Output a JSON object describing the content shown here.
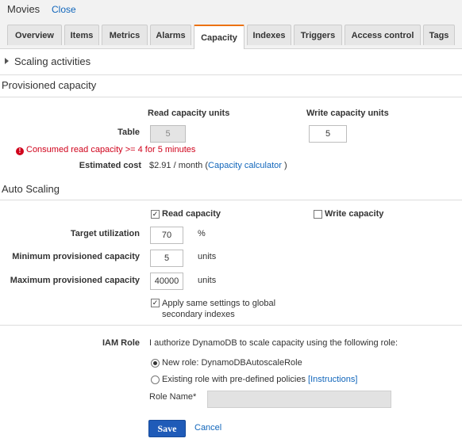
{
  "header": {
    "title": "Movies",
    "close_label": "Close"
  },
  "tabs": [
    {
      "label": "Overview"
    },
    {
      "label": "Items"
    },
    {
      "label": "Metrics"
    },
    {
      "label": "Alarms"
    },
    {
      "label": "Capacity",
      "active": true
    },
    {
      "label": "Indexes"
    },
    {
      "label": "Triggers"
    },
    {
      "label": "Access control"
    },
    {
      "label": "Tags"
    }
  ],
  "scaling_activities": {
    "label": "Scaling activities"
  },
  "provisioned": {
    "heading": "Provisioned capacity",
    "read_head": "Read capacity units",
    "write_head": "Write capacity units",
    "table_label": "Table",
    "read_value": "5",
    "write_value": "5",
    "error_text": "Consumed read capacity >= 4 for 5 minutes",
    "cost_label": "Estimated cost",
    "cost_value": "$2.91 / month",
    "cost_open": "(",
    "calc_link": "Capacity calculator",
    "cost_close": ")"
  },
  "auto_scaling": {
    "heading": "Auto Scaling",
    "read_cb_label": "Read capacity",
    "read_cb_checked": true,
    "write_cb_label": "Write capacity",
    "write_cb_checked": false,
    "target_label": "Target utilization",
    "target_value": "70",
    "target_unit": "%",
    "min_label": "Minimum provisioned capacity",
    "min_value": "5",
    "min_unit": "units",
    "max_label": "Maximum provisioned capacity",
    "max_value": "40000",
    "max_unit": "units",
    "apply_line1": "Apply same settings to global",
    "apply_line2": "secondary indexes",
    "apply_checked": true
  },
  "iam": {
    "label": "IAM Role",
    "description": "I authorize DynamoDB to scale capacity using the following role:",
    "new_role": "New role: DynamoDBAutoscaleRole",
    "existing_role": "Existing role with pre-defined policies",
    "instructions_link": "[Instructions]",
    "role_name_label": "Role Name*",
    "role_name_value": ""
  },
  "actions": {
    "save_label": "Save",
    "cancel_label": "Cancel"
  }
}
